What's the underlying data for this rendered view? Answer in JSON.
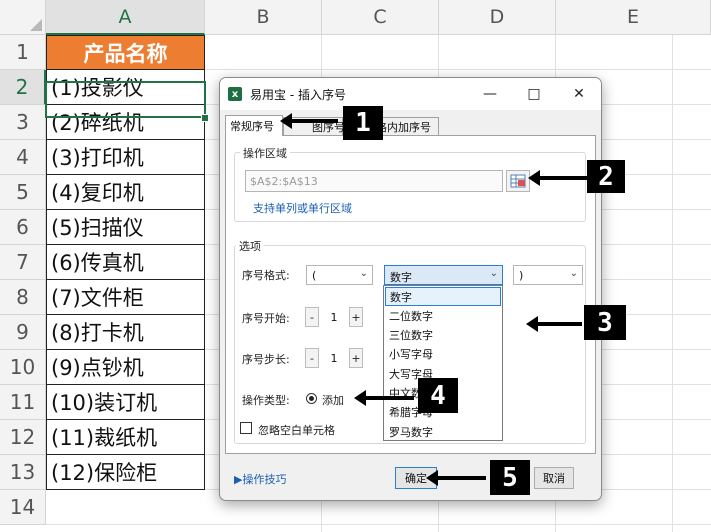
{
  "spreadsheet": {
    "columns": [
      "A",
      "B",
      "C",
      "D",
      "E"
    ],
    "rows": [
      "1",
      "2",
      "3",
      "4",
      "5",
      "6",
      "7",
      "8",
      "9",
      "10",
      "11",
      "12",
      "13",
      "14"
    ],
    "header_cell": "产品名称",
    "cells": [
      "(1)投影仪",
      "(2)碎纸机",
      "(3)打印机",
      "(4)复印机",
      "(5)扫描仪",
      "(6)传真机",
      "(7)文件柜",
      "(8)打卡机",
      "(9)点钞机",
      "(10)装订机",
      "(11)裁纸机",
      "(12)保险柜"
    ],
    "colors": {
      "header_fill": "#ed7d31",
      "selection": "#217346"
    }
  },
  "dialog": {
    "app_icon_letter": "x",
    "title": "易用宝 - 插入序号",
    "tabs": [
      "常规序号",
      "图序号",
      "格内加序号"
    ],
    "operation_area_label": "操作区域",
    "range_value": "$A$2:$A$13",
    "support_link": "支持单列或单行区域",
    "options_label": "选项",
    "format_label": "序号格式:",
    "prefix_value": "(",
    "number_type_value": "数字",
    "suffix_value": ")",
    "start_label": "序号开始:",
    "start_value": "1",
    "step_label": "序号步长:",
    "step_value": "1",
    "minus": "-",
    "plus": "+",
    "op_type_label": "操作类型:",
    "op_type_value": "添加",
    "ignore_blank_label": "忽略空白单元格",
    "tips_link": "▶操作技巧",
    "ok_label": "确定",
    "cancel_label": "取消",
    "dropdown_items": [
      "数字",
      "二位数字",
      "三位数字",
      "小写字母",
      "大写字母",
      "中文数字",
      "希腊字母",
      "罗马数字"
    ]
  },
  "annotations": [
    "1",
    "2",
    "3",
    "4",
    "5"
  ]
}
